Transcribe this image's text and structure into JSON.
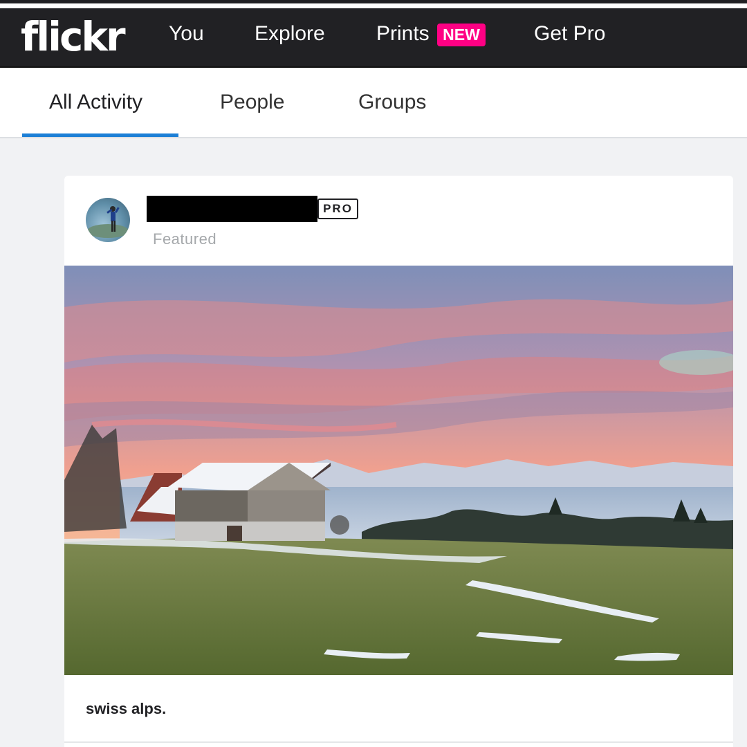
{
  "nav": {
    "logo": "flickr",
    "items": [
      "You",
      "Explore",
      "Prints",
      "Get Pro"
    ],
    "new_badge": "NEW",
    "bar_color": "#212124",
    "badge_color": "#ff0084"
  },
  "tabs": {
    "items": [
      "All Activity",
      "People",
      "Groups"
    ],
    "active": "All Activity",
    "underline_color": "#1c7fd6"
  },
  "post": {
    "pro_badge": "PRO",
    "subtitle": "Featured",
    "caption": "swiss alps.",
    "avatar_icon": "user-avatar",
    "photo_icon": "landscape-photo"
  }
}
